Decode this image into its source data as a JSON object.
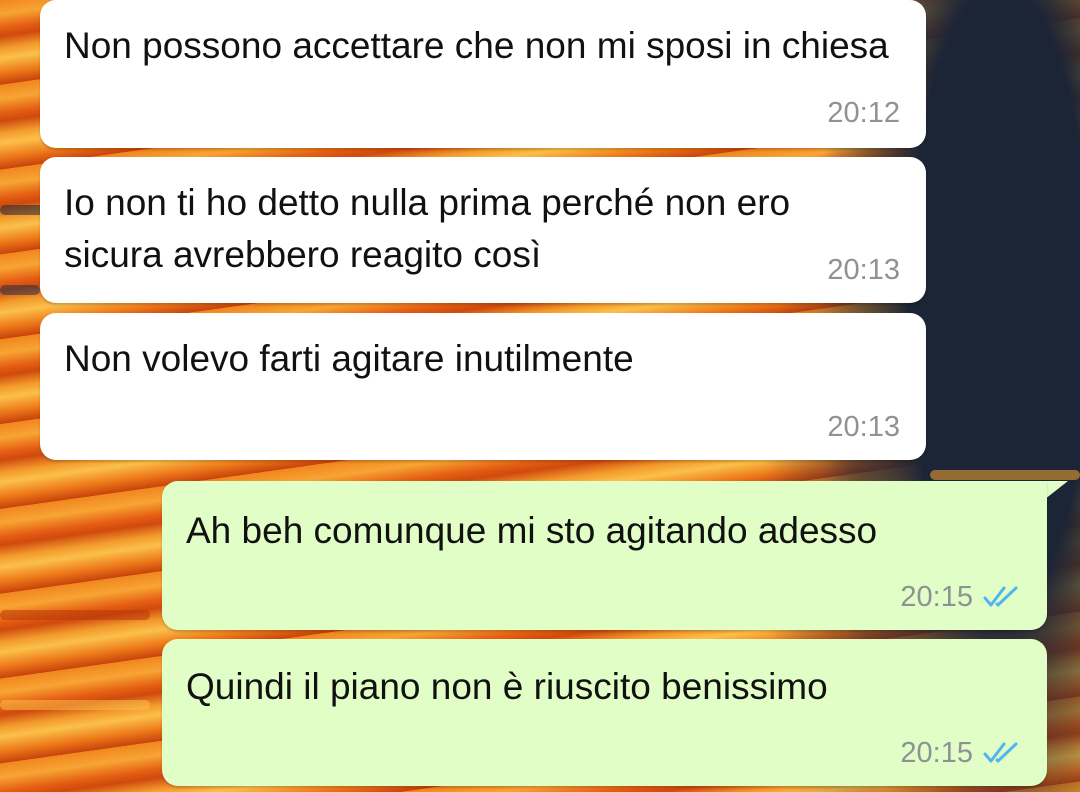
{
  "messages": [
    {
      "direction": "incoming",
      "text": "Non possono accettare che non mi sposi in chiesa",
      "time": "20:12"
    },
    {
      "direction": "incoming",
      "text": "Io non ti ho detto nulla prima perché non ero sicura avrebbero reagito così",
      "time": "20:13"
    },
    {
      "direction": "incoming",
      "text": "Non volevo farti agitare inutilmente",
      "time": "20:13"
    },
    {
      "direction": "outgoing",
      "text": "Ah beh comunque mi sto agitando adesso",
      "time": "20:15",
      "status_icon": "double-check-read-icon"
    },
    {
      "direction": "outgoing",
      "text": "Quindi il piano non è riuscito benissimo",
      "time": "20:15",
      "status_icon": "double-check-read-icon"
    }
  ],
  "colors": {
    "incoming_bubble": "#ffffff",
    "outgoing_bubble": "#e1fec6",
    "timestamp": "#8f9295",
    "read_check": "#4fb6ec",
    "wallpaper_orange": "#e8701c",
    "wallpaper_dark": "#1c2535"
  }
}
